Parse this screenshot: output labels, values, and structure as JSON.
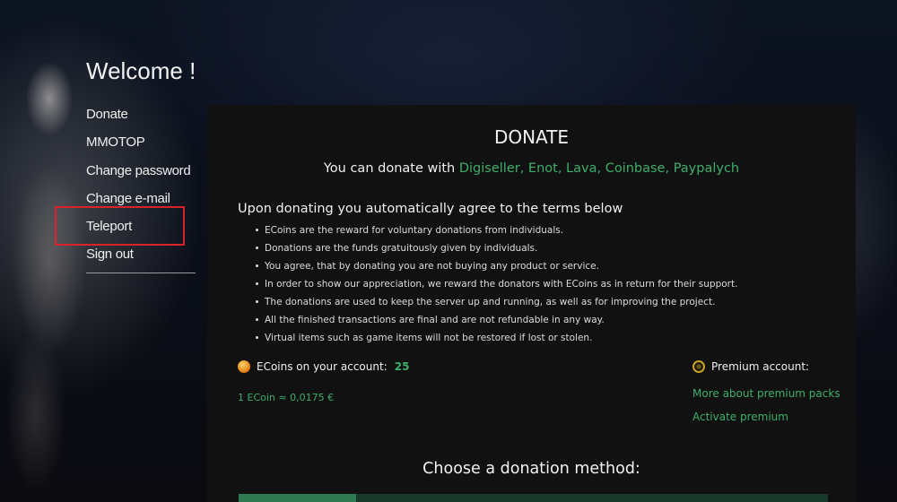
{
  "sidebar": {
    "welcome": "Welcome !",
    "items": [
      {
        "label": "Donate"
      },
      {
        "label": "MMOTOP"
      },
      {
        "label": "Change password"
      },
      {
        "label": "Change e-mail"
      },
      {
        "label": "Teleport"
      },
      {
        "label": "Sign out"
      }
    ]
  },
  "main": {
    "title": "DONATE",
    "donate_with_prefix": "You can donate with ",
    "payment_methods": "Digiseller, Enot, Lava, Coinbase, Paypalych",
    "terms_heading": "Upon donating you automatically agree to the terms below",
    "terms": [
      "ECoins are the reward for voluntary donations from individuals.",
      "Donations are the funds gratuitously given by individuals.",
      "You agree, that by donating you are not buying any product or service.",
      "In order to show our appreciation, we reward the donators with ECoins as in return for their support.",
      "The donations are used to keep the server up and running, as well as for improving the project.",
      "All the finished transactions are final and are not refundable in any way.",
      "Virtual items such as game items will not be restored if lost or stolen."
    ],
    "ecoins_label": "ECoins on your account:",
    "ecoins_value": "25",
    "rate": "1 ECoin ≈ 0,0175 €",
    "premium_label": "Premium account:",
    "premium_more": "More about premium packs",
    "premium_activate": "Activate premium",
    "choose_method": "Choose a donation method:"
  },
  "colors": {
    "accent_green": "#3fae6a",
    "highlight_red": "#d9232a",
    "panel_bg": "#111111"
  },
  "icons": {
    "coin": "coin-icon",
    "premium": "premium-icon"
  }
}
